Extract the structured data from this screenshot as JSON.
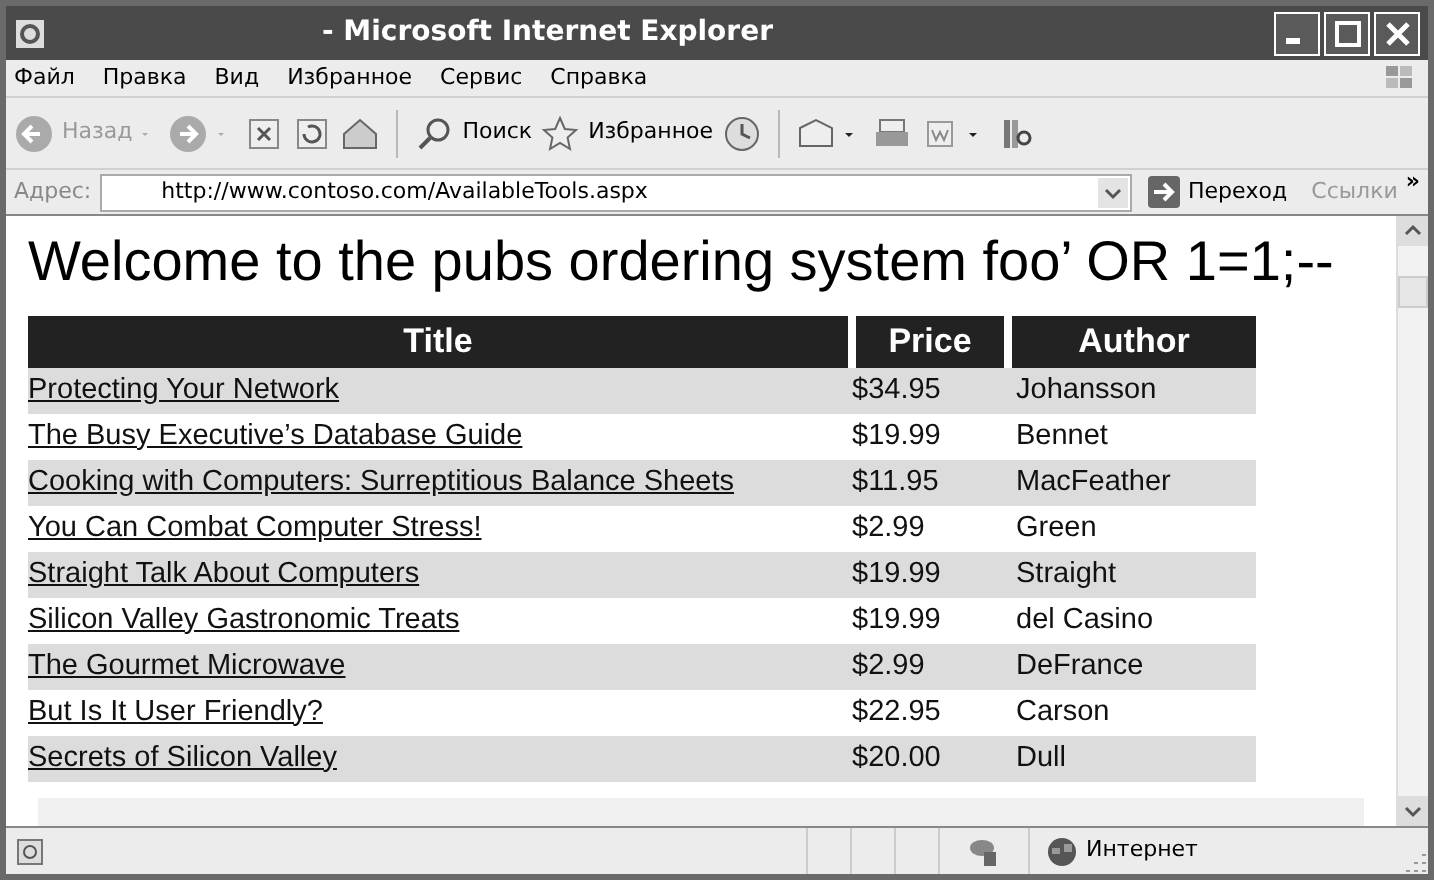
{
  "window": {
    "title": "- Microsoft Internet Explorer"
  },
  "menu": [
    "Файл",
    "Правка",
    "Вид",
    "Избранное",
    "Сервис",
    "Справка"
  ],
  "toolbar": {
    "back": "Назад",
    "search": "Поиск",
    "favorites": "Избранное"
  },
  "address_bar": {
    "label": "Адрес:",
    "url": "http://www.contoso.com/AvailableTools.aspx",
    "go": "Переход",
    "links": "Ссылки",
    "more": "»"
  },
  "page": {
    "heading": "Welcome to the pubs ordering system foo’ OR 1=1;--",
    "table": {
      "columns": [
        "Title",
        "Price",
        "Author"
      ],
      "rows": [
        {
          "title": "Protecting Your Network",
          "price": "$34.95",
          "author": "Johansson"
        },
        {
          "title": "The Busy Executive’s Database Guide",
          "price": "$19.99",
          "author": "Bennet"
        },
        {
          "title": "Cooking with Computers: Surreptitious Balance Sheets",
          "price": "$11.95",
          "author": "MacFeather"
        },
        {
          "title": "You Can Combat Computer Stress!",
          "price": "$2.99",
          "author": "Green"
        },
        {
          "title": "Straight Talk About Computers",
          "price": "$19.99",
          "author": "Straight"
        },
        {
          "title": "Silicon Valley Gastronomic Treats",
          "price": "$19.99",
          "author": "del Casino"
        },
        {
          "title": "The Gourmet Microwave",
          "price": "$2.99",
          "author": "DeFrance"
        },
        {
          "title": "But Is It User Friendly?",
          "price": "$22.95",
          "author": "Carson"
        },
        {
          "title": "Secrets of Silicon Valley",
          "price": "$20.00",
          "author": "Dull"
        }
      ]
    }
  },
  "status_bar": {
    "zone": "Интернет"
  }
}
